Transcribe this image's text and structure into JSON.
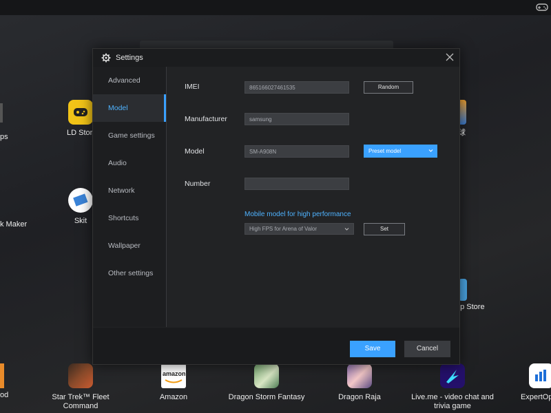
{
  "window": {
    "title": "Settings"
  },
  "desktop": {
    "left_items": [
      {
        "label": "ps"
      },
      {
        "label": "k Maker"
      }
    ],
    "items": [
      {
        "label": "LD Store"
      },
      {
        "label": "Skit"
      },
      {
        "label": "球"
      },
      {
        "label": "pp Store"
      }
    ],
    "dock": [
      {
        "label": "od"
      },
      {
        "label": "Star Trek™ Fleet Command"
      },
      {
        "label": "Amazon"
      },
      {
        "label": "Dragon Storm Fantasy"
      },
      {
        "label": "Dragon Raja"
      },
      {
        "label": "Live.me - video chat and trivia game"
      },
      {
        "label": "ExpertOp"
      }
    ],
    "amazon_icon_text": "amazon"
  },
  "sidebar": {
    "items": [
      {
        "label": "Advanced"
      },
      {
        "label": "Model"
      },
      {
        "label": "Game settings"
      },
      {
        "label": "Audio"
      },
      {
        "label": "Network"
      },
      {
        "label": "Shortcuts"
      },
      {
        "label": "Wallpaper"
      },
      {
        "label": "Other settings"
      }
    ],
    "active_index": 1
  },
  "form": {
    "imei": {
      "label": "IMEI",
      "value": "865166027461535",
      "button": "Random"
    },
    "manufacturer": {
      "label": "Manufacturer",
      "value": "samsung"
    },
    "model": {
      "label": "Model",
      "value": "SM-A908N",
      "button": "Preset model"
    },
    "number": {
      "label": "Number",
      "value": ""
    },
    "performance": {
      "link": "Mobile model for high performance",
      "selected": "High FPS for Arena of Valor",
      "button": "Set"
    }
  },
  "footer": {
    "save_label": "Save",
    "cancel_label": "Cancel"
  },
  "colors": {
    "accent": "#3aa1ff",
    "dialog_bg": "#222325",
    "field_bg": "#3c3e42"
  }
}
